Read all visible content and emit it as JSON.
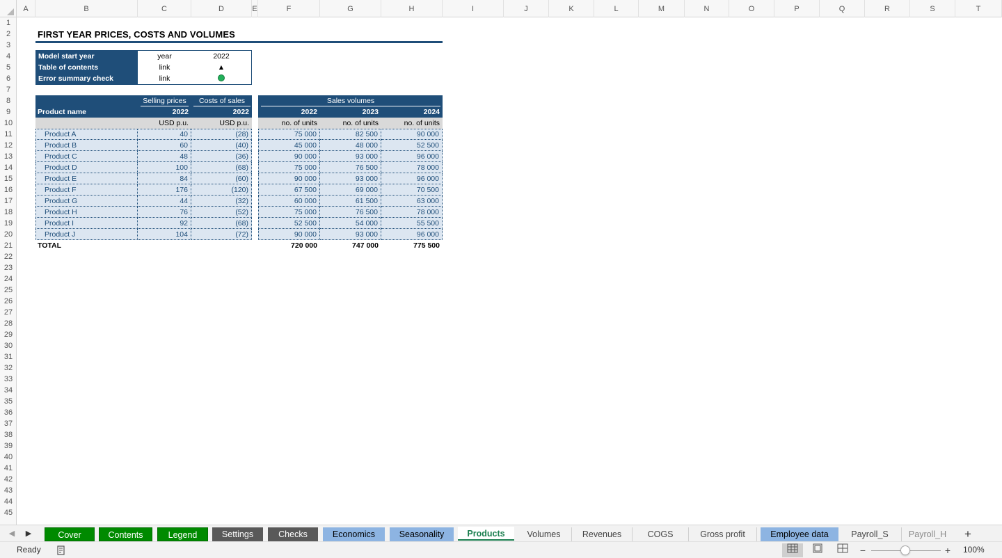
{
  "columns": [
    "A",
    "B",
    "C",
    "D",
    "E",
    "F",
    "G",
    "H",
    "I",
    "J",
    "K",
    "L",
    "M",
    "N",
    "O",
    "P",
    "Q",
    "R",
    "S",
    "T"
  ],
  "rows": [
    "1",
    "2",
    "3",
    "4",
    "5",
    "6",
    "7",
    "8",
    "9",
    "10",
    "11",
    "12",
    "13",
    "14",
    "15",
    "16",
    "17",
    "18",
    "19",
    "20",
    "21",
    "22",
    "23",
    "24",
    "25",
    "26",
    "27",
    "28",
    "29",
    "30",
    "31",
    "32",
    "33",
    "34",
    "35",
    "36",
    "37",
    "38",
    "39",
    "40",
    "41",
    "42",
    "43",
    "44",
    "45"
  ],
  "sheet": {
    "title": "FIRST YEAR PRICES, COSTS AND VOLUMES",
    "info": [
      {
        "label": "Model start year",
        "unit": "year",
        "value": "2022"
      },
      {
        "label": "Table of contents",
        "unit": "link",
        "value": "▲"
      },
      {
        "label": "Error summary check",
        "unit": "link",
        "value": "●"
      }
    ],
    "status_color": "#21b05a",
    "headers": {
      "selling_prices": "Selling prices",
      "costs_of_sales": "Costs of sales",
      "sales_volumes": "Sales volumes",
      "product_name": "Product name",
      "years": [
        "2022",
        "2022",
        "2022",
        "2023",
        "2024"
      ],
      "units": [
        "USD p.u.",
        "USD p.u.",
        "no. of units",
        "no. of units",
        "no. of units"
      ]
    },
    "products": [
      {
        "name": "Product A",
        "price": "40",
        "cost": "(28)",
        "v2022": "75 000",
        "v2023": "82 500",
        "v2024": "90 000"
      },
      {
        "name": "Product B",
        "price": "60",
        "cost": "(40)",
        "v2022": "45 000",
        "v2023": "48 000",
        "v2024": "52 500"
      },
      {
        "name": "Product C",
        "price": "48",
        "cost": "(36)",
        "v2022": "90 000",
        "v2023": "93 000",
        "v2024": "96 000"
      },
      {
        "name": "Product D",
        "price": "100",
        "cost": "(68)",
        "v2022": "75 000",
        "v2023": "76 500",
        "v2024": "78 000"
      },
      {
        "name": "Product E",
        "price": "84",
        "cost": "(60)",
        "v2022": "90 000",
        "v2023": "93 000",
        "v2024": "96 000"
      },
      {
        "name": "Product F",
        "price": "176",
        "cost": "(120)",
        "v2022": "67 500",
        "v2023": "69 000",
        "v2024": "70 500"
      },
      {
        "name": "Product G",
        "price": "44",
        "cost": "(32)",
        "v2022": "60 000",
        "v2023": "61 500",
        "v2024": "63 000"
      },
      {
        "name": "Product H",
        "price": "76",
        "cost": "(52)",
        "v2022": "75 000",
        "v2023": "76 500",
        "v2024": "78 000"
      },
      {
        "name": "Product I",
        "price": "92",
        "cost": "(68)",
        "v2022": "52 500",
        "v2023": "54 000",
        "v2024": "55 500"
      },
      {
        "name": "Product J",
        "price": "104",
        "cost": "(72)",
        "v2022": "90 000",
        "v2023": "93 000",
        "v2024": "96 000"
      }
    ],
    "total": {
      "label": "TOTAL",
      "v2022": "720 000",
      "v2023": "747 000",
      "v2024": "775 500"
    }
  },
  "tabs": [
    {
      "label": "Cover",
      "style": "green"
    },
    {
      "label": "Contents",
      "style": "green"
    },
    {
      "label": "Legend",
      "style": "green"
    },
    {
      "label": "Settings",
      "style": "darkgray"
    },
    {
      "label": "Checks",
      "style": "darkgray"
    },
    {
      "label": "Economics",
      "style": "blue"
    },
    {
      "label": "Seasonality",
      "style": "blue"
    },
    {
      "label": "Products",
      "style": "active"
    },
    {
      "label": "Volumes",
      "style": "plain"
    },
    {
      "label": "Revenues",
      "style": "plain"
    },
    {
      "label": "COGS",
      "style": "plain"
    },
    {
      "label": "Gross profit",
      "style": "plain"
    },
    {
      "label": "Employee data",
      "style": "blue"
    },
    {
      "label": "Payroll_S",
      "style": "plain"
    },
    {
      "label": "Payroll_H",
      "style": "plain"
    }
  ],
  "tab_nav": {
    "prev": "◀",
    "next": "▶",
    "add": "+"
  },
  "status": {
    "text": "Ready",
    "zoom": "100%",
    "zoom_minus": "−",
    "zoom_plus": "+"
  },
  "icons": {
    "accessibility": "accessibility-icon",
    "normal_view": "normal-view-icon",
    "page_layout": "page-layout-icon",
    "page_break": "page-break-preview-icon"
  }
}
